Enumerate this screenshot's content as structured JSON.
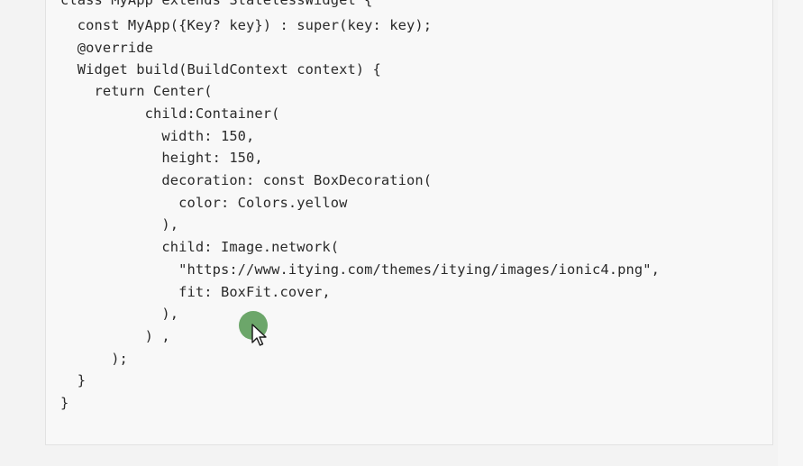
{
  "code": {
    "lines": [
      "class MyApp extends StatelessWidget {",
      "  const MyApp({Key? key}) : super(key: key);",
      "  @override",
      "  Widget build(BuildContext context) {",
      "    return Center(",
      "          child:Container(",
      "            width: 150,",
      "            height: 150,",
      "            decoration: const BoxDecoration(",
      "              color: Colors.yellow",
      "            ),",
      "            child: Image.network(",
      "              \"https://www.itying.com/themes/itying/images/ionic4.png\",",
      "              fit: BoxFit.cover,",
      "            ),",
      "          ) ,",
      "      );",
      "  }",
      "}"
    ]
  },
  "cursor": {
    "icon": "arrow-pointer-icon",
    "click_indicator_color": "#5f9e5d"
  },
  "colors": {
    "background": "#f3f3f3",
    "code_background": "#f8f8f8",
    "text": "#2a2a2a"
  }
}
